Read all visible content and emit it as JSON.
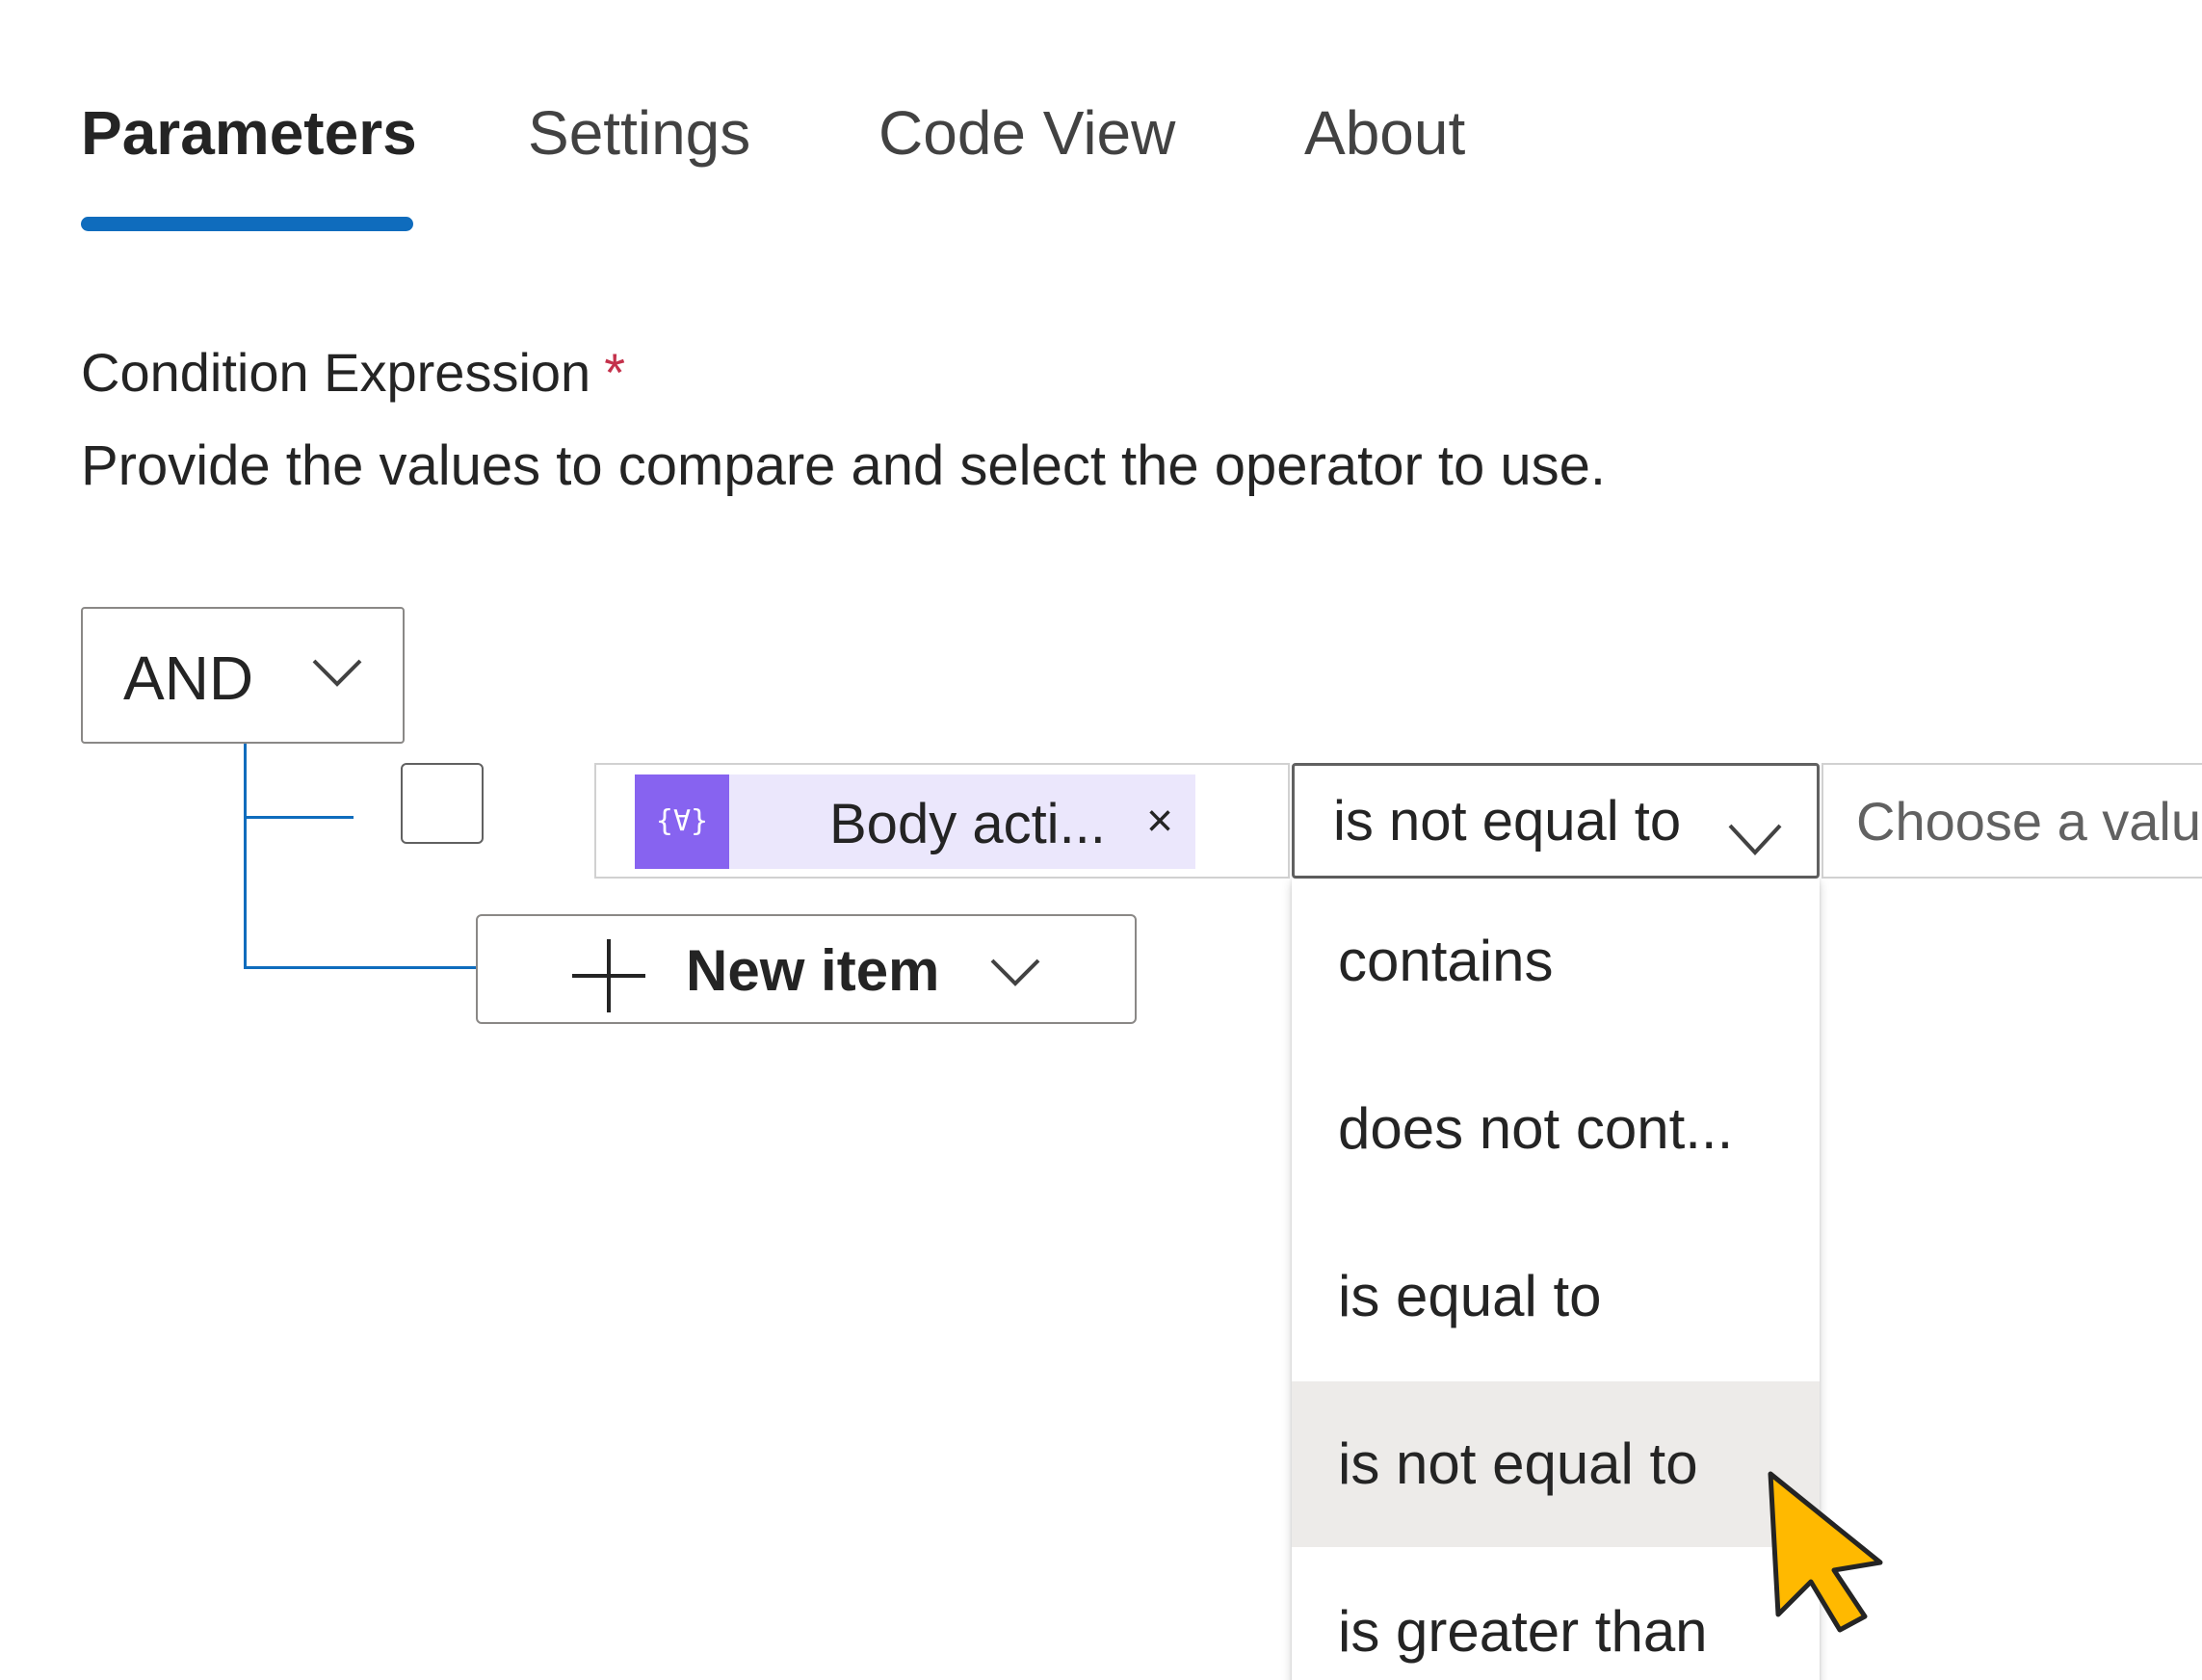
{
  "tabs": [
    {
      "label": "Parameters",
      "active": true
    },
    {
      "label": "Settings",
      "active": false
    },
    {
      "label": "Code View",
      "active": false
    },
    {
      "label": "About",
      "active": false
    }
  ],
  "field": {
    "label": "Condition Expression",
    "required_mark": "*",
    "description": "Provide the values to compare and select the operator to use."
  },
  "group": {
    "operator": "AND"
  },
  "condition_row": {
    "checked": false,
    "left_operand": {
      "token_icon": "{∀}",
      "token_label": "Body acti...",
      "remove_glyph": "×"
    },
    "operator_value": "is not equal to",
    "right_operand_placeholder": "Choose a value"
  },
  "new_item_label": "New item",
  "operator_menu": {
    "options": [
      {
        "label": "contains"
      },
      {
        "label": "does not cont..."
      },
      {
        "label": "is equal to"
      },
      {
        "label": "is not equal to"
      },
      {
        "label": "is greater than"
      }
    ],
    "hovered_index": 3
  },
  "colors": {
    "accent": "#0f6cbd",
    "token_background": "#ebe7fc",
    "token_icon": "#8763f0",
    "required": "#c4314b",
    "hover": "#edebe9",
    "cursor": "#ffb900"
  },
  "icons": {
    "and_dropdown": "chevron-down-icon",
    "operator_dropdown": "chevron-down-icon",
    "token": "dynamic-content-icon",
    "token_remove": "close-icon",
    "new_item": "plus-icon",
    "new_item_menu": "chevron-down-icon",
    "pointer": "mouse-pointer-icon"
  }
}
